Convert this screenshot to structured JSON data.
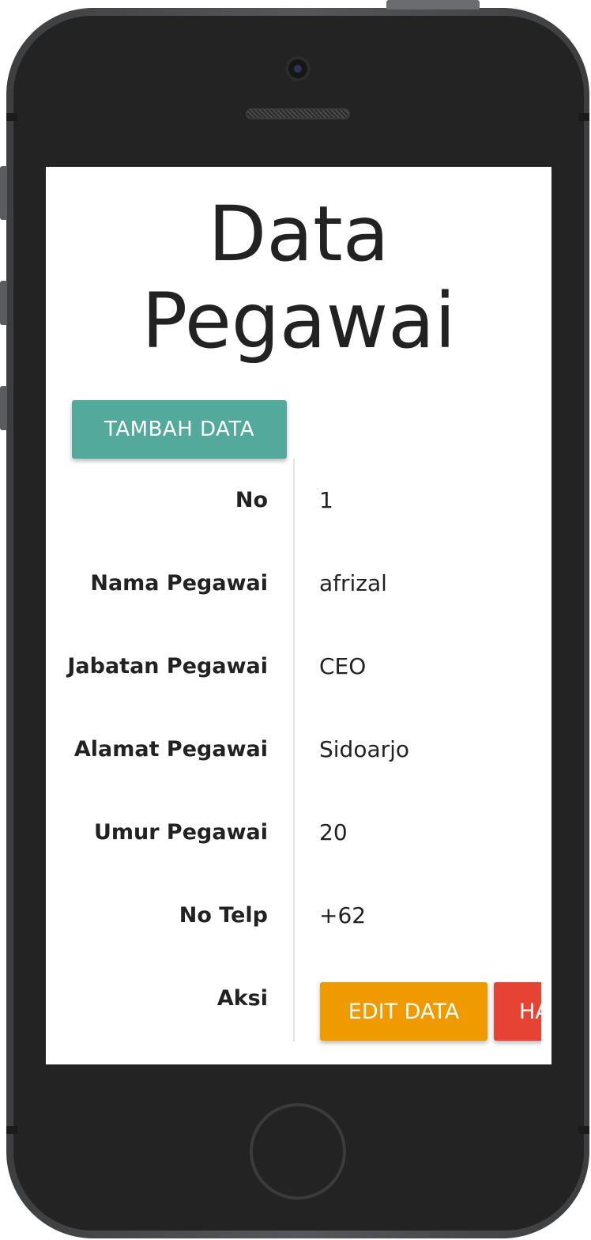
{
  "page": {
    "title": "Data Pegawai",
    "add_button_label": "TAMBAH DATA"
  },
  "record": {
    "rows": [
      {
        "label": "No",
        "value": "1"
      },
      {
        "label": "Nama Pegawai",
        "value": "afrizal"
      },
      {
        "label": "Jabatan Pegawai",
        "value": "CEO"
      },
      {
        "label": "Alamat Pegawai",
        "value": "Sidoarjo"
      },
      {
        "label": "Umur Pegawai",
        "value": "20"
      },
      {
        "label": "No Telp",
        "value": "+62"
      }
    ],
    "actions_label": "Aksi",
    "edit_button_label": "EDIT DATA",
    "delete_button_label": "HAPUS DATA"
  },
  "colors": {
    "add_button": "#52a99c",
    "edit_button": "#ef9a00",
    "delete_button": "#e74335",
    "text": "#222222"
  }
}
